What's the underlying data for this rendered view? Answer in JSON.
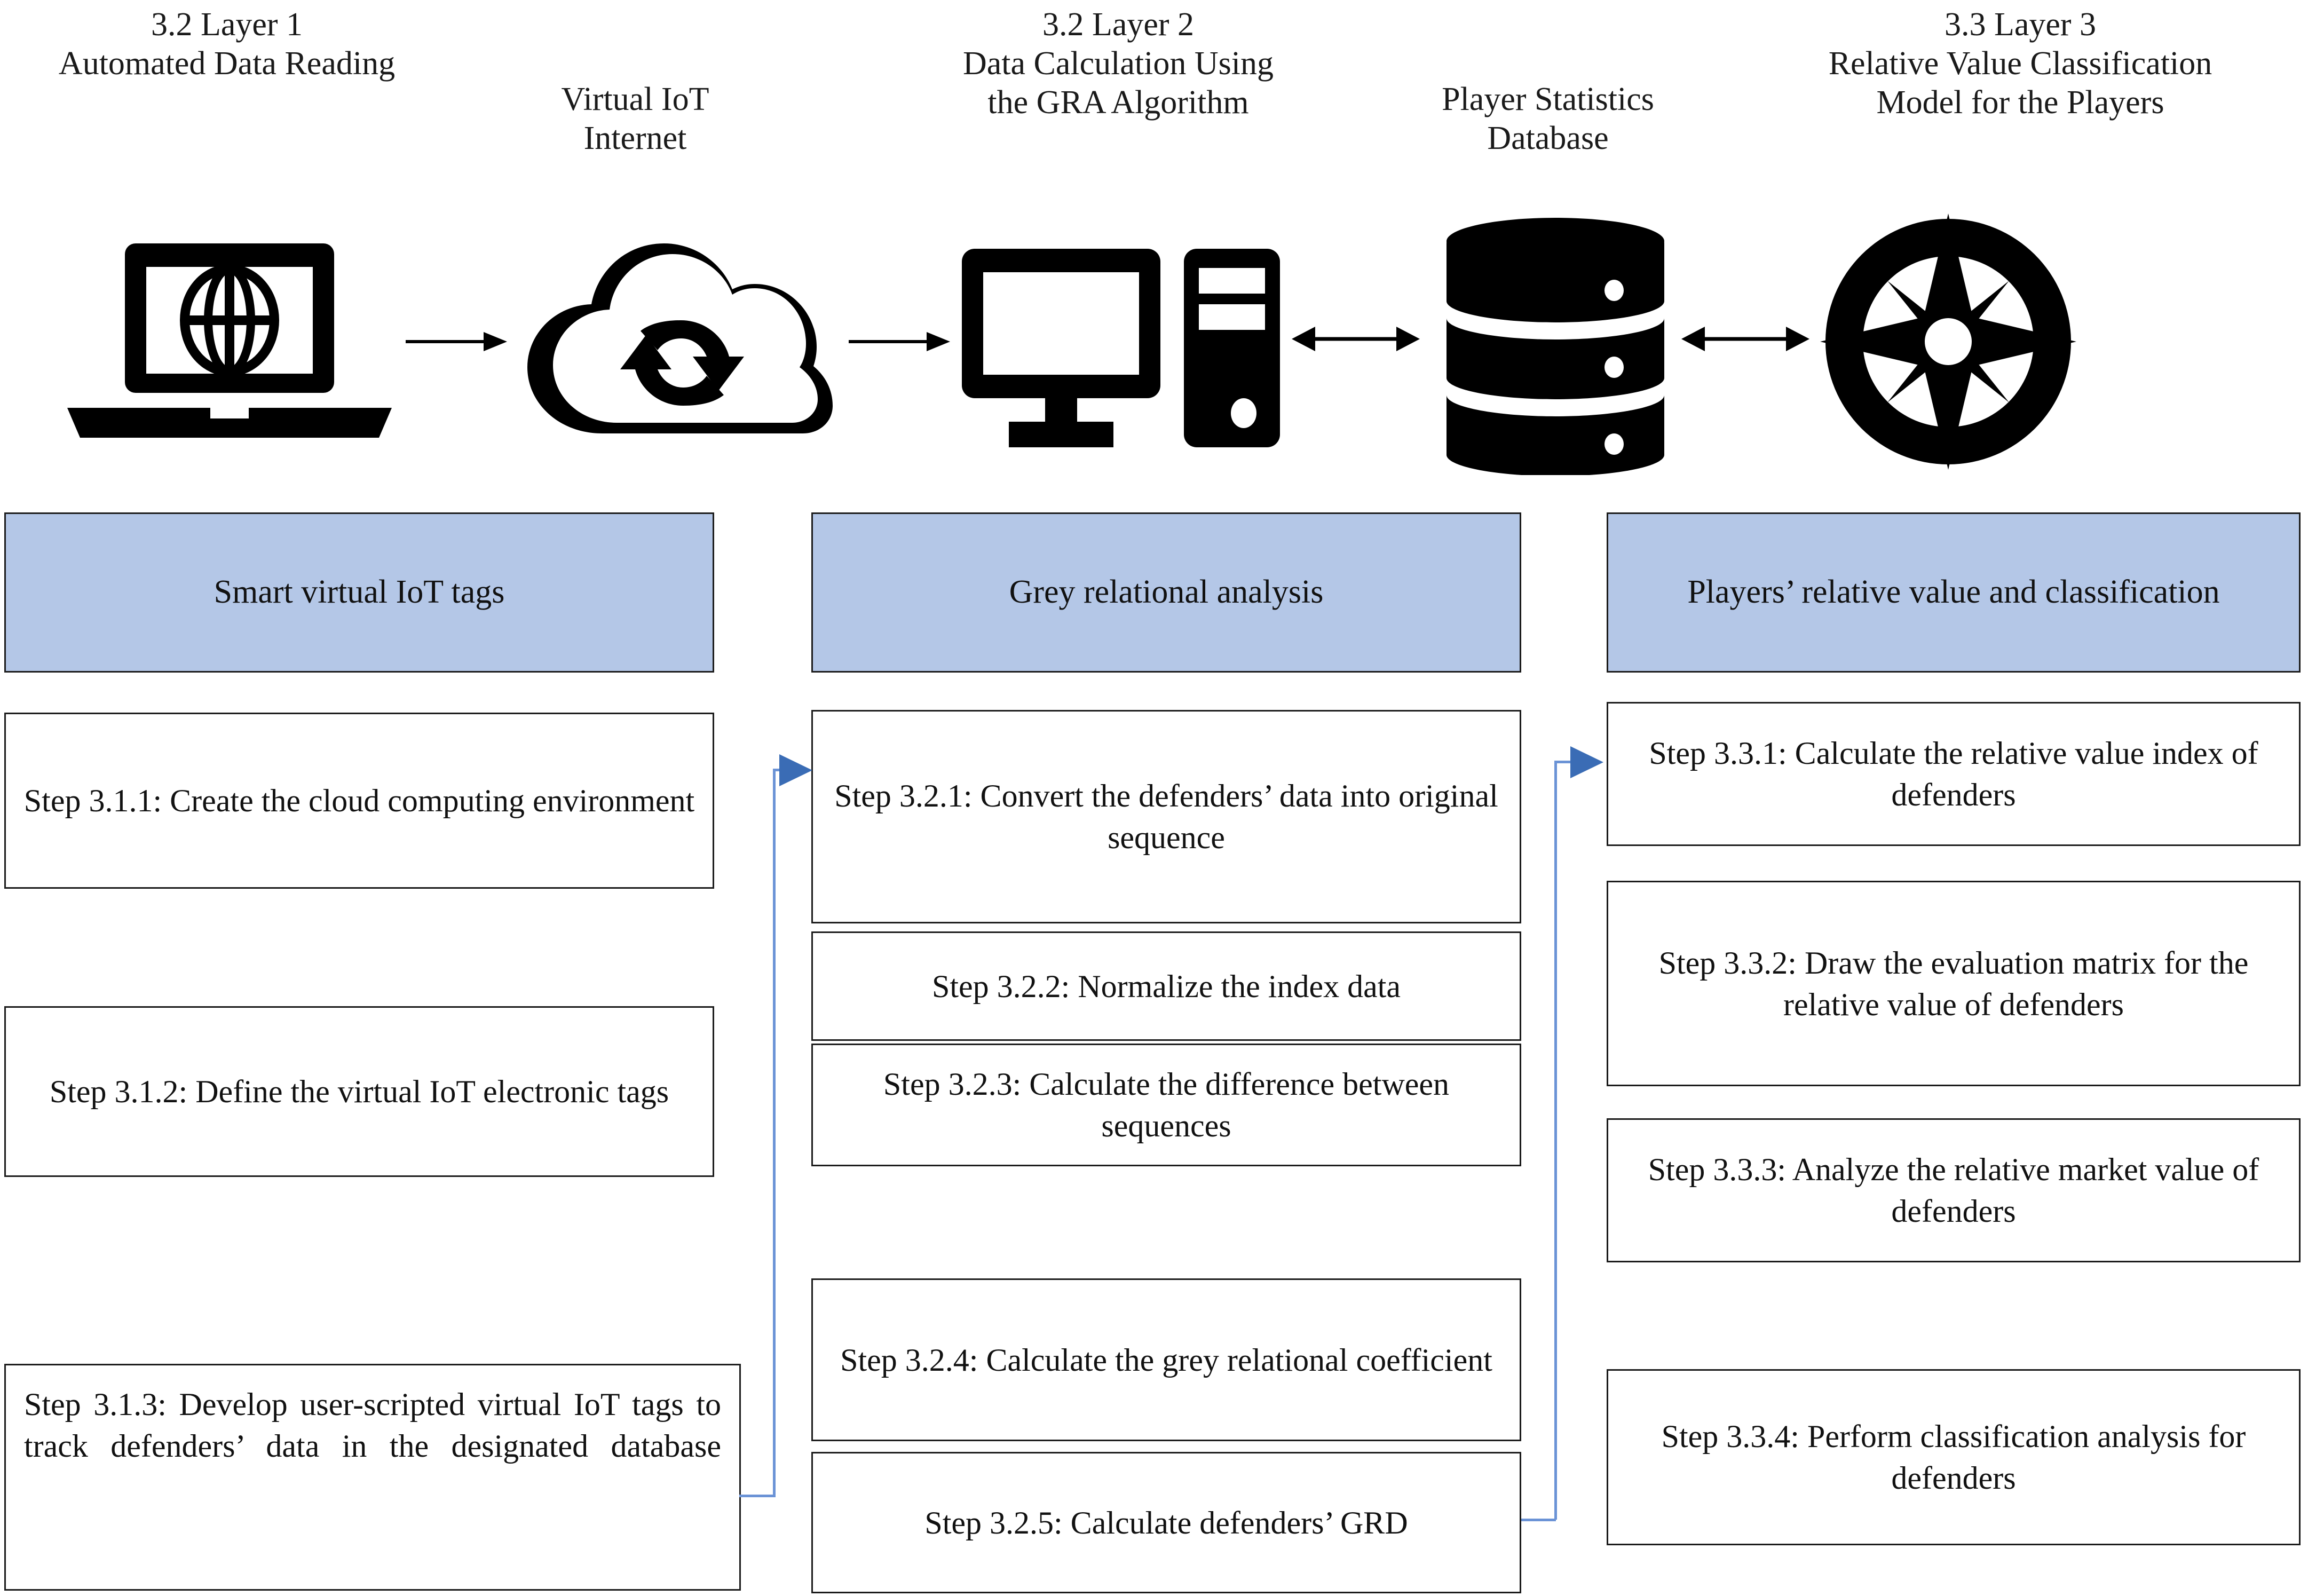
{
  "top_labels": [
    {
      "id": "layer1",
      "line1": "3.2 Layer 1",
      "line2": "Automated Data Reading"
    },
    {
      "id": "virtual_iot",
      "line1": "Virtual IoT",
      "line2": "Internet"
    },
    {
      "id": "layer2",
      "line1": "3.2 Layer 2",
      "line2": "Data Calculation Using",
      "line3": "the GRA Algorithm"
    },
    {
      "id": "player_db",
      "line1": "Player Statistics",
      "line2": "Database"
    },
    {
      "id": "layer3",
      "line1": "3.3 Layer 3",
      "line2": "Relative Value Classification",
      "line3": "Model for the Players"
    }
  ],
  "icons": [
    {
      "name": "laptop-globe-icon",
      "label": "Automated Data Reading"
    },
    {
      "name": "cloud-sync-icon",
      "label": "Virtual IoT Internet"
    },
    {
      "name": "desktop-computer-icon",
      "label": "Data Calculation"
    },
    {
      "name": "database-icon",
      "label": "Player Statistics Database"
    },
    {
      "name": "compass-rose-icon",
      "label": "Relative Value Classification"
    }
  ],
  "flow_arrows": [
    {
      "name": "arrow-laptop-to-cloud",
      "direction": "right"
    },
    {
      "name": "arrow-cloud-to-computer",
      "direction": "right"
    },
    {
      "name": "arrow-computer-to-database",
      "direction": "both"
    },
    {
      "name": "arrow-database-to-compass",
      "direction": "both"
    }
  ],
  "columns": [
    {
      "id": "col-iot",
      "header": "Smart virtual IoT tags",
      "steps": [
        {
          "id": "step-3-1-1",
          "text": "Step 3.1.1: Create the cloud computing environment"
        },
        {
          "id": "step-3-1-2",
          "text": "Step 3.1.2: Define the virtual IoT electronic tags"
        },
        {
          "id": "step-3-1-3",
          "text": "Step 3.1.3: Develop user-scripted virtual IoT tags to track defenders’ data in the designated database"
        }
      ]
    },
    {
      "id": "col-gra",
      "header": "Grey relational analysis",
      "steps": [
        {
          "id": "step-3-2-1",
          "text": "Step 3.2.1: Convert the defenders’ data into original sequence"
        },
        {
          "id": "step-3-2-2",
          "text": "Step 3.2.2: Normalize the index data"
        },
        {
          "id": "step-3-2-3",
          "text": "Step 3.2.3: Calculate the difference between sequences"
        },
        {
          "id": "step-3-2-4",
          "text": "Step 3.2.4: Calculate the grey relational coefficient"
        },
        {
          "id": "step-3-2-5",
          "text": "Step 3.2.5: Calculate defenders’ GRD"
        }
      ]
    },
    {
      "id": "col-value",
      "header": "Players’ relative value and classification",
      "steps": [
        {
          "id": "step-3-3-1",
          "text": "Step 3.3.1: Calculate the relative value index of defenders"
        },
        {
          "id": "step-3-3-2",
          "text": "Step 3.3.2: Draw the evaluation matrix for the relative value of defenders"
        },
        {
          "id": "step-3-3-3",
          "text": "Step 3.3.3: Analyze the relative market value of defenders"
        },
        {
          "id": "step-3-3-4",
          "text": "Step 3.3.4: Perform classification analysis for defenders"
        }
      ]
    }
  ],
  "connectors": [
    {
      "name": "connector-col1-to-col2",
      "from": "step-3-1-3",
      "to": "step-3-2-1"
    },
    {
      "name": "connector-col2-to-col3",
      "from": "step-3-2-5",
      "to": "step-3-3-1"
    }
  ],
  "colors": {
    "header_fill": "#b4c7e7",
    "box_border": "#1b1b1b",
    "connector": "#6b93d6",
    "connector_head": "#3a6cb5",
    "icon": "#000000",
    "background": "#ffffff"
  }
}
